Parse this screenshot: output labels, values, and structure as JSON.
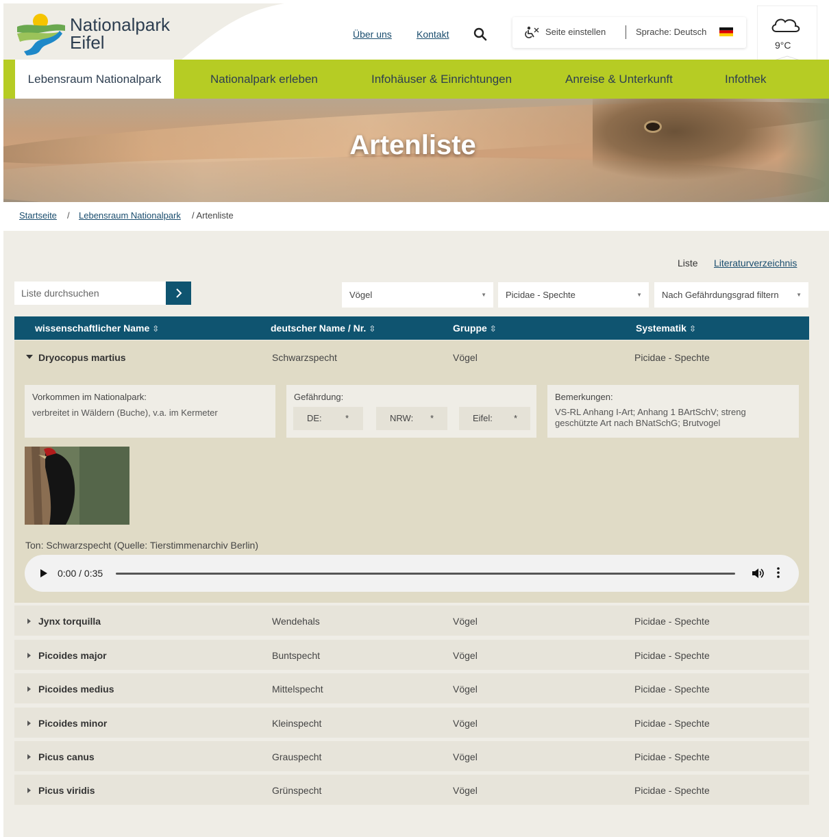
{
  "site": {
    "logo_line1": "Nationalpark",
    "logo_line2": "Eifel",
    "links": [
      "Über uns",
      "Kontakt"
    ],
    "settings_label": "Seite einstellen",
    "language_label": "Sprache: Deutsch",
    "weather_temp": "9°C"
  },
  "nav": {
    "items": [
      "Lebensraum Nationalpark",
      "Nationalpark erleben",
      "Infohäuser & Einrichtungen",
      "Anreise & Unterkunft",
      "Infothek"
    ],
    "active_index": 0
  },
  "hero": {
    "title": "Artenliste"
  },
  "breadcrumb": {
    "items": [
      "Startseite",
      "Lebensraum Nationalpark"
    ],
    "separator": "/",
    "current": "/ Artenliste"
  },
  "views": {
    "liste": "Liste",
    "literatur": "Literaturverzeichnis"
  },
  "filters": {
    "search_placeholder": "Liste durchsuchen",
    "group": "Vögel",
    "family": "Picidae - Spechte",
    "threat": "Nach Gefährdungsgrad filtern"
  },
  "table": {
    "headers": [
      "wissenschaftlicher Name",
      "deutscher Name / Nr.",
      "Gruppe",
      "Systematik"
    ],
    "sort_glyph": "⇳",
    "expanded": {
      "sci": "Dryocopus martius",
      "german": "Schwarzspecht",
      "group": "Vögel",
      "system": "Picidae - Spechte",
      "occurrence_label": "Vorkommen im Nationalpark:",
      "occurrence_text": "verbreitet in Wäldern (Buche), v.a. im Kermeter",
      "threat_label": "Gefährdung:",
      "threats": [
        {
          "k": "DE:",
          "v": "*"
        },
        {
          "k": "NRW:",
          "v": "*"
        },
        {
          "k": "Eifel:",
          "v": "*"
        }
      ],
      "remarks_label": "Bemerkungen:",
      "remarks_line1": "VS-RL Anhang I-Art; Anhang 1 BArtSchV; streng",
      "remarks_line2": "geschützte Art nach BNatSchG; Brutvogel",
      "audio_label": "Ton: Schwarzspecht (Quelle: Tierstimmenarchiv Berlin)",
      "audio_time": "0:00 / 0:35"
    },
    "rows": [
      {
        "sci": "Jynx torquilla",
        "german": "Wendehals",
        "group": "Vögel",
        "system": "Picidae - Spechte"
      },
      {
        "sci": "Picoides major",
        "german": "Buntspecht",
        "group": "Vögel",
        "system": "Picidae - Spechte"
      },
      {
        "sci": "Picoides medius",
        "german": "Mittelspecht",
        "group": "Vögel",
        "system": "Picidae - Spechte"
      },
      {
        "sci": "Picoides minor",
        "german": "Kleinspecht",
        "group": "Vögel",
        "system": "Picidae - Spechte"
      },
      {
        "sci": "Picus canus",
        "german": "Grauspecht",
        "group": "Vögel",
        "system": "Picidae - Spechte"
      },
      {
        "sci": "Picus viridis",
        "german": "Grünspecht",
        "group": "Vögel",
        "system": "Picidae - Spechte"
      }
    ]
  },
  "colors": {
    "accent_green": "#b6cc24",
    "dark_teal": "#0f5470",
    "bg_beige": "#efede6"
  }
}
